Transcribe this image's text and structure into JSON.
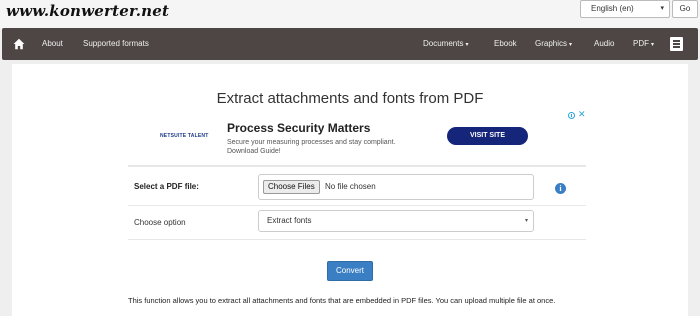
{
  "header": {
    "logo": "www.konwerter.net",
    "language": "English (en)",
    "go_label": "Go"
  },
  "nav": {
    "about": "About",
    "supported_formats": "Supported formats",
    "documents": "Documents",
    "ebook": "Ebook",
    "graphics": "Graphics",
    "audio": "Audio",
    "pdf": "PDF",
    "caret": "▾"
  },
  "page": {
    "title": "Extract attachments and fonts from PDF"
  },
  "ad": {
    "advertiser": "NETSUITE TALENT",
    "headline": "Process Security Matters",
    "body": "Secure your measuring processes and stay compliant. Download Guide!",
    "cta": "VISIT SITE",
    "close": "✕"
  },
  "form": {
    "file_label": "Select a PDF file:",
    "choose_button": "Choose Files",
    "file_status": "No file chosen",
    "info": "i",
    "option_label": "Choose option",
    "option_value": "Extract fonts",
    "submit": "Convert"
  },
  "description": "This function allows you to extract all attachments and fonts that are embedded in PDF files. You can upload multiple file at once."
}
